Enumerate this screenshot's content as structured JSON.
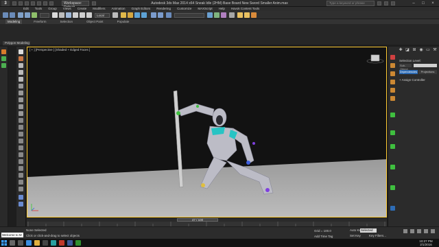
{
  "app": {
    "title": "Autodesk 3ds Max 2014 x64    Sneak Idle (2HM) Base Board New Sword Smaller Anim.max",
    "workspace": "Workspace: Default",
    "search_placeholder": "Type a keyword or phrase",
    "logo": "3"
  },
  "menu": [
    "Edit",
    "Tools",
    "Group",
    "Views",
    "Create",
    "Modifiers",
    "Animation",
    "Graph Editors",
    "Rendering",
    "Customize",
    "MAXScript",
    "Help",
    "Havok Content Tools"
  ],
  "toolbar": {
    "ref_coord": "Local"
  },
  "ribbon": {
    "tabs": [
      "Modeling",
      "Freeform",
      "Selection",
      "Object Paint",
      "Populate"
    ],
    "panel_label": "Polygon Modeling"
  },
  "viewport": {
    "label": "[ + ] [Perspective ] [Shaded + Edged Faces ]"
  },
  "command_panel": {
    "selection_level_label": "Selection Level:",
    "sub_object_label": "Sub-Object",
    "dependencies_btn": "Dependencies",
    "projections_btn": "Projections",
    "assign_controller": "+  Assign Controller"
  },
  "timeline": {
    "frame_readout": "47 / 100",
    "progress": 0.47
  },
  "status": {
    "selection": "None Selected",
    "prompt": "Click or click-and-drag to select objects",
    "maxscript": "Welcome to M",
    "grid": "Grid = 100.0",
    "add_time_tag": "Add Time Tag",
    "auto_key": "Auto Key",
    "selected": "Selected",
    "set_key": "Set Key",
    "key_filters": "Key Filters..."
  },
  "taskbar": {
    "time": "10:27 PM",
    "date": "2/1/2016"
  },
  "colors": {
    "active_border": "#ffcc33",
    "accent_blue": "#2e6cb5"
  }
}
